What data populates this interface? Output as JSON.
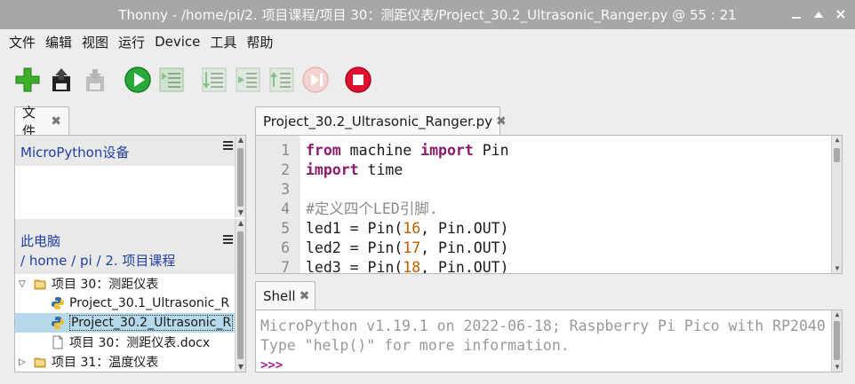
{
  "window": {
    "title": "Thonny  -  /home/pi/2. 项目课程/项目 30：测距仪表/Project_30.2_Ultrasonic_Ranger.py  @  55 : 21"
  },
  "menu": [
    "文件",
    "编辑",
    "视图",
    "运行",
    "Device",
    "工具",
    "帮助"
  ],
  "toolbar": [
    {
      "name": "new-file",
      "icon": "green-plus-icon"
    },
    {
      "name": "load-file",
      "icon": "load-icon"
    },
    {
      "name": "save-file",
      "icon": "save-icon"
    },
    {
      "name": "run",
      "icon": "play-icon"
    },
    {
      "name": "debug",
      "icon": "debug-icon"
    },
    {
      "name": "step-over",
      "icon": "step-over-icon"
    },
    {
      "name": "step-into",
      "icon": "step-into-icon"
    },
    {
      "name": "step-out",
      "icon": "step-out-icon"
    },
    {
      "name": "resume",
      "icon": "resume-icon"
    },
    {
      "name": "stop",
      "icon": "stop-icon"
    }
  ],
  "files": {
    "tab_label": "文件",
    "micropython_header": "MicroPython设备",
    "computer_header": "此电脑",
    "path": {
      "root": "/",
      "home": "home",
      "sep1": "/",
      "pi": "pi",
      "sep2": "/",
      "folder": "2. 项目课程"
    },
    "tree": [
      {
        "label": "项目 30：测距仪表",
        "type": "folder",
        "expanded": true
      },
      {
        "label": "Project_30.1_Ultrasonic_R",
        "type": "python"
      },
      {
        "label": "Project_30.2_Ultrasonic_R",
        "type": "python",
        "selected": true
      },
      {
        "label": "项目 30：测距仪表.docx",
        "type": "doc"
      },
      {
        "label": "项目 31：温度仪表",
        "type": "folder",
        "expanded": false
      }
    ]
  },
  "editor": {
    "tab_label": "Project_30.2_Ultrasonic_Ranger.py",
    "lines": [
      {
        "n": "1",
        "code": [
          [
            "kw",
            "from"
          ],
          [
            "t",
            " machine "
          ],
          [
            "kw",
            "import"
          ],
          [
            "t",
            " Pin"
          ]
        ]
      },
      {
        "n": "2",
        "code": [
          [
            "kw",
            "import"
          ],
          [
            "t",
            " time"
          ]
        ]
      },
      {
        "n": "3",
        "code": []
      },
      {
        "n": "4",
        "code": [
          [
            "cm",
            "#定义四个LED引脚."
          ]
        ]
      },
      {
        "n": "5",
        "code": [
          [
            "t",
            "led1 = Pin("
          ],
          [
            "num",
            "16"
          ],
          [
            "t",
            ", Pin.OUT)"
          ]
        ]
      },
      {
        "n": "6",
        "code": [
          [
            "t",
            "led2 = Pin("
          ],
          [
            "num",
            "17"
          ],
          [
            "t",
            ", Pin.OUT)"
          ]
        ]
      },
      {
        "n": "7",
        "code": [
          [
            "t",
            "led3 = Pin("
          ],
          [
            "num",
            "18"
          ],
          [
            "t",
            ", Pin.OUT)"
          ]
        ]
      }
    ]
  },
  "shell": {
    "tab_label": "Shell",
    "lines": [
      "MicroPython v1.19.1 on 2022-06-18; Raspberry Pi Pico with RP2040",
      "Type \"help()\" for more information."
    ],
    "prompt": ">>>"
  },
  "colors": {
    "keyword": "#8b1b6b",
    "number": "#c25b00",
    "comment": "#8a8a8a",
    "link": "#1f3fa5",
    "selection": "#b5d8ea"
  }
}
